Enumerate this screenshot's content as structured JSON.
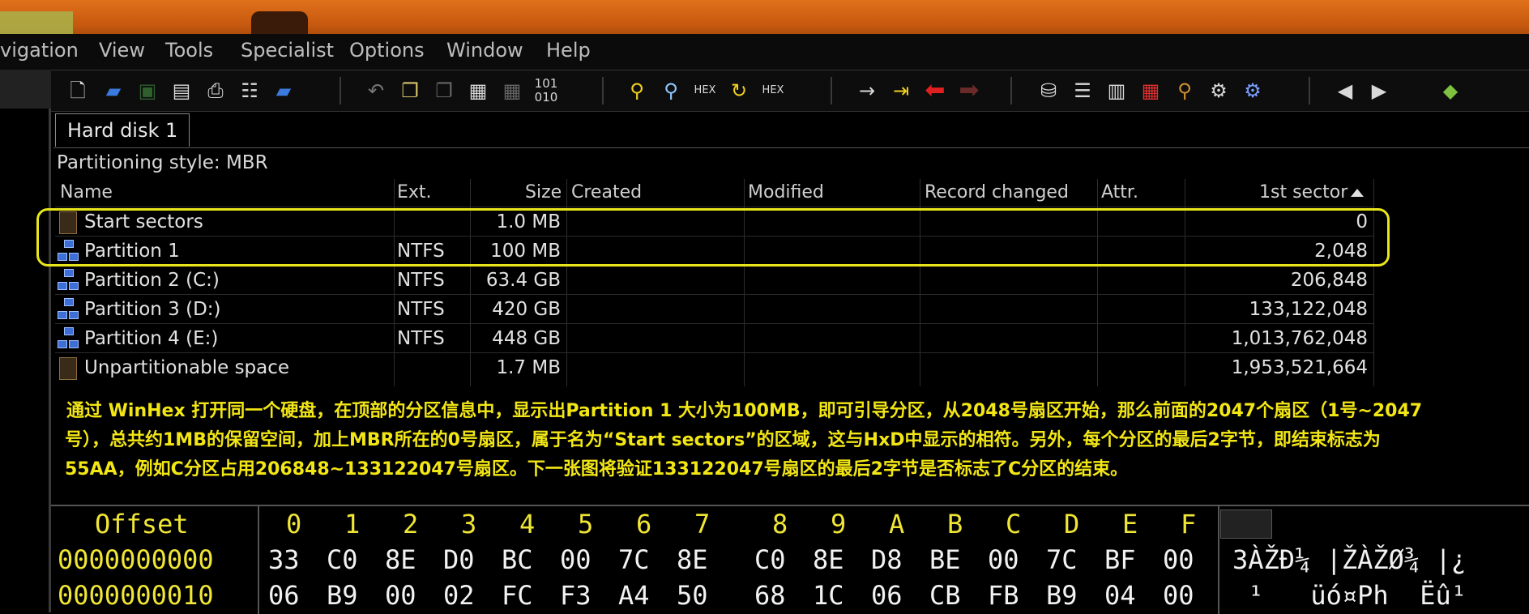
{
  "menu": [
    "vigation",
    "View",
    "Tools",
    "Specialist",
    "Options",
    "Window",
    "Help"
  ],
  "toolbar_icons": [
    "new-file-icon",
    "open-folder-icon",
    "save-icon",
    "save-all-icon",
    "print-icon",
    "properties-icon",
    "open-disk-icon",
    "undo-icon",
    "copy-icon",
    "copy-block-icon",
    "paste-icon",
    "paste-into-icon",
    "binary-edit-icon",
    "find-text-icon",
    "find-hex-icon",
    "replace-text-icon",
    "replace-hex-icon",
    "find-special-icon",
    "goto-offset-icon",
    "goto-sector-icon",
    "back-arrow-icon",
    "forward-arrow-icon",
    "open-disk-drive-icon",
    "disk-stack-icon",
    "ram-icon",
    "calculator-icon",
    "search-icon",
    "clone-disk-icon",
    "options-icon",
    "previous-sector-icon",
    "next-sector-icon",
    "bookmark-icon"
  ],
  "tab": "Hard disk 1",
  "partitioning_style": "Partitioning style: MBR",
  "columns": [
    "Name",
    "Ext.",
    "Size",
    "Created",
    "Modified",
    "Record changed",
    "Attr.",
    "1st sector"
  ],
  "rows": [
    {
      "name": "Start sectors",
      "ext": "",
      "size": "1.0 MB",
      "first_sector": "0",
      "icon": "file-icon"
    },
    {
      "name": "Partition 1",
      "ext": "NTFS",
      "size": "100 MB",
      "first_sector": "2,048",
      "icon": "partition-icon"
    },
    {
      "name": "Partition 2 (C:)",
      "ext": "NTFS",
      "size": "63.4 GB",
      "first_sector": "206,848",
      "icon": "partition-icon"
    },
    {
      "name": "Partition 3 (D:)",
      "ext": "NTFS",
      "size": "420 GB",
      "first_sector": "133,122,048",
      "icon": "partition-icon"
    },
    {
      "name": "Partition 4 (E:)",
      "ext": "NTFS",
      "size": "448 GB",
      "first_sector": "1,013,762,048",
      "icon": "partition-icon"
    },
    {
      "name": "Unpartitionable space",
      "ext": "",
      "size": "1.7 MB",
      "first_sector": "1,953,521,664",
      "icon": "file-icon"
    }
  ],
  "annotation": [
    "通过 WinHex 打开同一个硬盘，在顶部的分区信息中，显示出Partition 1 大小为100MB，即可引导分区，从2048号扇区开始，那么前面的2047个扇区（1号~2047",
    "号），总共约1MB的保留空间，加上MBR所在的0号扇区，属于名为“Start sectors”的区域，这与HxD中显示的相符。另外，每个分区的最后2字节，即结束标志为",
    "55AA，例如C分区占用206848~133122047号扇区。下一张图将验证133122047号扇区的最后2字节是否标志了C分区的结束。"
  ],
  "hex": {
    "offset_label": "Offset",
    "columns": [
      "0",
      "1",
      "2",
      "3",
      "4",
      "5",
      "6",
      "7",
      "8",
      "9",
      "A",
      "B",
      "C",
      "D",
      "E",
      "F"
    ],
    "lines": [
      {
        "offset": "0000000000",
        "bytes": [
          "33",
          "C0",
          "8E",
          "D0",
          "BC",
          "00",
          "7C",
          "8E",
          "C0",
          "8E",
          "D8",
          "BE",
          "00",
          "7C",
          "BF",
          "00"
        ],
        "text": "3ÀŽÐ¼ |ŽÀŽØ¾ |¿"
      },
      {
        "offset": "0000000010",
        "bytes": [
          "06",
          "B9",
          "00",
          "02",
          "FC",
          "F3",
          "A4",
          "50",
          "68",
          "1C",
          "06",
          "CB",
          "FB",
          "B9",
          "04",
          "00"
        ],
        "text": " ¹   üó¤Ph  Ëû¹ "
      }
    ]
  },
  "colors": {
    "highlight": "#e8e61a",
    "annotation_text": "#f2e615",
    "hex_offset": "#f0e635",
    "title_bar": "#c85a10"
  }
}
